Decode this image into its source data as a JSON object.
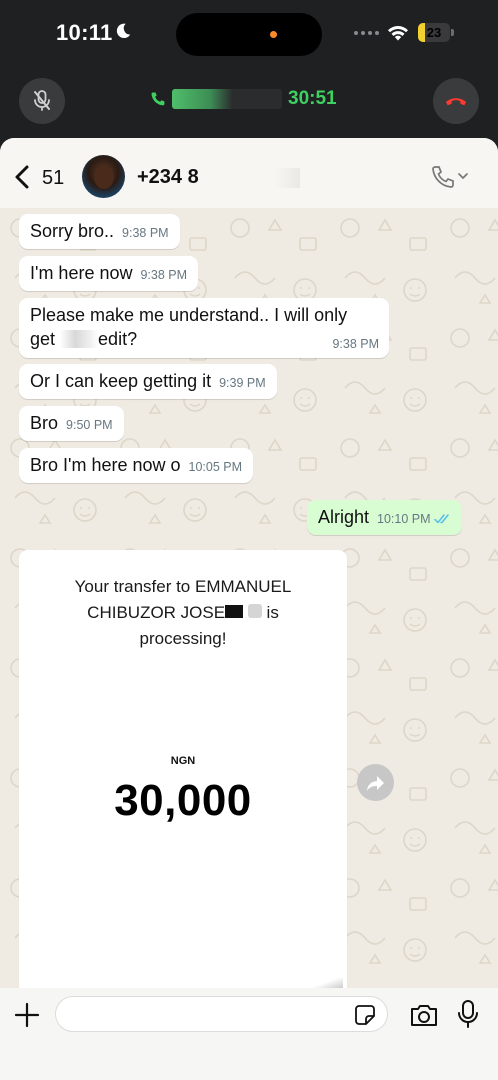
{
  "status_bar": {
    "time": "10:11",
    "battery": "23",
    "battery_level": 0.23
  },
  "call_banner": {
    "timer": "30:51"
  },
  "chat_header": {
    "unread_count": "51",
    "contact_name": "+234 8"
  },
  "messages": [
    {
      "dir": "in",
      "text": "Sorry bro..",
      "time": "9:38 PM"
    },
    {
      "dir": "in",
      "text": "I'm here now",
      "time": "9:38 PM"
    },
    {
      "dir": "in",
      "text_before": "Please make me understand.. I will only",
      "text_line2_start": "get",
      "text_line2_end": "edit?",
      "time": "9:38 PM"
    },
    {
      "dir": "in",
      "text": "Or I can keep getting it",
      "time": "9:39 PM"
    },
    {
      "dir": "in",
      "text": "Bro",
      "time": "9:50 PM"
    },
    {
      "dir": "in",
      "text": "Bro I'm here now o",
      "time": "10:05 PM"
    },
    {
      "dir": "out",
      "text": "Alright",
      "time": "10:10 PM"
    }
  ],
  "receipt": {
    "line1": "Your transfer to EMMANUEL",
    "line2_start": "CHIBUZOR JOSE",
    "line2_end": "is",
    "line3": "processing!",
    "currency": "NGN",
    "amount": "30,000"
  },
  "composer": {
    "input_value": "",
    "input_placeholder": ""
  },
  "colors": {
    "call_green": "#3ed060",
    "end_call_red": "#ff3b30",
    "outgoing_bubble": "#d9fdd3",
    "read_ticks": "#53bdeb"
  }
}
